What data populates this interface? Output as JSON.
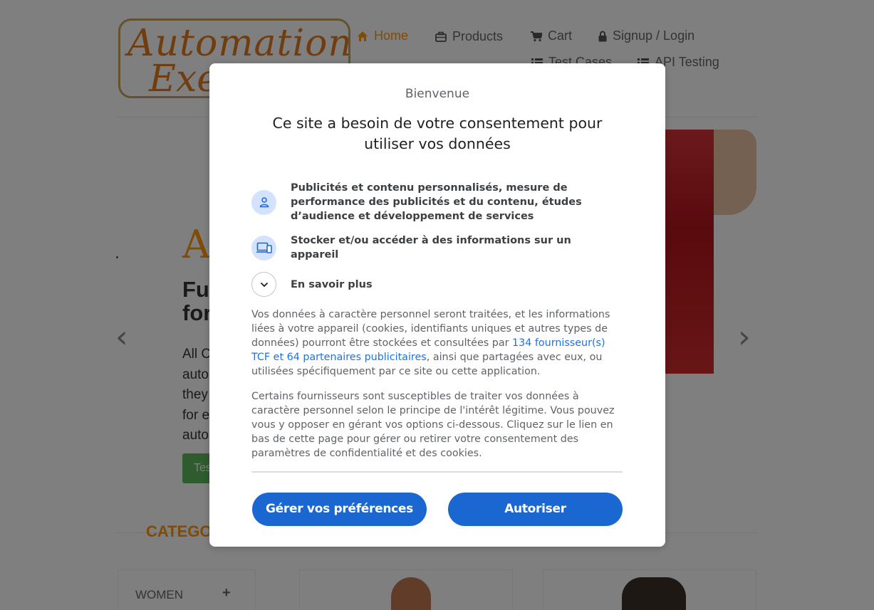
{
  "header": {
    "logo": {
      "line1": "Automation",
      "line2": "Exe"
    },
    "nav": [
      {
        "label": "Home",
        "icon": "home-icon",
        "active": true
      },
      {
        "label": "Products",
        "icon": "briefcase-icon"
      },
      {
        "label": "Cart",
        "icon": "cart-icon"
      },
      {
        "label": "Signup / Login",
        "icon": "lock-icon"
      },
      {
        "label": "Test Cases",
        "icon": "list-icon"
      },
      {
        "label": "API Testing",
        "icon": "list-icon"
      }
    ]
  },
  "hero": {
    "heading_partial": "A",
    "subheading_line1": "Ful",
    "subheading_line2": "for",
    "text_lines": [
      "All C",
      "auto",
      "they",
      "for e",
      "auto"
    ],
    "button_label": "Tes",
    "prev_arrow": "‹",
    "next_arrow": "›"
  },
  "categories": {
    "title": "CATEGORY",
    "items": [
      {
        "label": "WOMEN",
        "toggle": "+"
      }
    ]
  },
  "consent": {
    "welcome": "Bienvenue",
    "title": "Ce site a besoin de votre consentement pour utiliser vos données",
    "purposes": [
      {
        "icon": "person-icon",
        "text": "Publicités et contenu personnalisés, mesure de performance des publicités et du contenu, études d’audience et développement de services"
      },
      {
        "icon": "devices-icon",
        "text": "Stocker et/ou accéder à des informations sur un appareil"
      },
      {
        "icon": "chevron-down-icon",
        "text": "En savoir plus"
      }
    ],
    "paragraph1_before": "Vos données à caractère personnel seront traitées, et les informations liées à votre appareil (cookies, identifiants uniques et autres types de données) pourront être stockées et consultées par ",
    "paragraph1_link": "134 fournisseur(s) TCF et 64 partenaires publicitaires",
    "paragraph1_after": ", ainsi que partagées avec eux, ou utilisées spécifiquement par ce site ou cette application.",
    "paragraph2": "Certains fournisseurs sont susceptibles de traiter vos données à caractère personnel selon le principe de l'intérêt légitime. Vous pouvez vous y opposer en gérant vos options ci-dessous. Cliquez sur le lien en bas de cette page pour gérer ou retirer votre consentement des paramètres de confidentialité et des cookies.",
    "manage_button": "Gérer vos préférences",
    "accept_button": "Autoriser"
  },
  "colors": {
    "accent_orange": "#fe980f",
    "consent_blue": "#1a67d2",
    "link_blue": "#1a73e8"
  }
}
